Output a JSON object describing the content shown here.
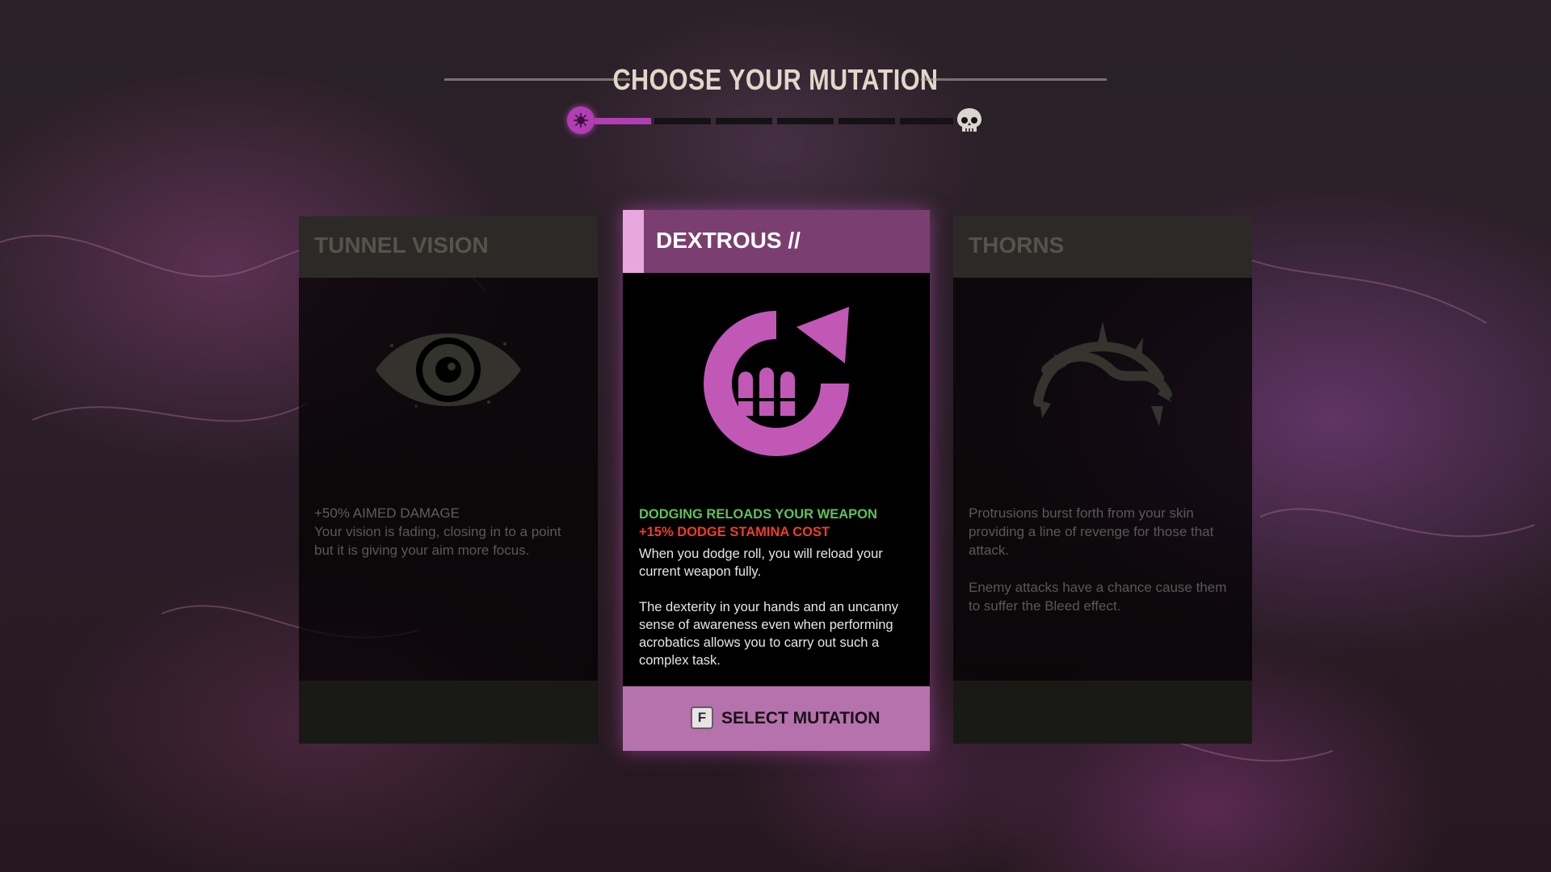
{
  "header": {
    "title": "CHOOSE YOUR MUTATION",
    "progress": {
      "total_segments": 6,
      "filled_segments": 1
    }
  },
  "colors": {
    "accent": "#b13eb4",
    "selected_header": "#7a3f70",
    "select_button": "#b572ac",
    "positive": "#5ec25a",
    "negative": "#f03c2a"
  },
  "cards": [
    {
      "title": "TUNNEL VISION",
      "icon": "eye-icon",
      "stat": "+50% AIMED DAMAGE",
      "lore": "Your vision is fading, closing in to a point but it is giving your aim more focus.",
      "selected": false
    },
    {
      "title": "DEXTROUS //",
      "icon": "reload-bullets-icon",
      "buff": "DODGING RELOADS YOUR WEAPON",
      "debuff": "+15% DODGE STAMINA COST",
      "effect": "When you dodge roll, you will reload your current weapon fully.",
      "lore": "The dexterity in your hands and an uncanny sense of awareness even when performing acrobatics allows you to carry out such a complex task.",
      "selected": true,
      "action": {
        "key": "F",
        "label": "SELECT MUTATION"
      }
    },
    {
      "title": "THORNS",
      "icon": "thorn-crown-icon",
      "lore": "Protrusions burst forth from your skin providing a line of revenge for those that attack.",
      "effect": "Enemy attacks have a chance cause them to suffer the Bleed effect.",
      "selected": false
    }
  ]
}
